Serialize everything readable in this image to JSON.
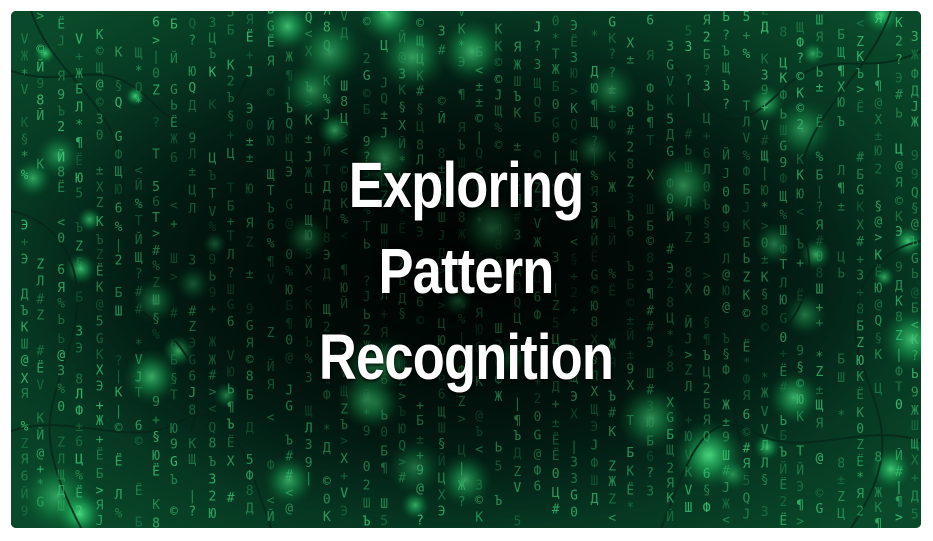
{
  "banner": {
    "title_lines": [
      "Exploring",
      "Pattern",
      "Recognition"
    ]
  },
  "colors": {
    "background": "#02140c",
    "glow": "#20e070",
    "glyph": "#3fd07a",
    "title": "#ffffff",
    "frame": "#ffffff"
  },
  "background_glyphs": [
    "Й",
    "К",
    "Ж",
    "Ш",
    "Ё",
    "Ъ",
    "Щ",
    "Ц",
    "Б",
    "Ф",
    "Я",
    "Ю",
    "Э",
    "Ь",
    "Д",
    "Л",
    "G",
    "V",
    "Q",
    "X",
    "Z",
    "T",
    "J",
    "K",
    "3",
    "6",
    "8",
    "9",
    "2",
    "5",
    "0",
    "¶",
    "§",
    "@",
    "#",
    "%",
    "±",
    "©",
    "?",
    "*",
    "+",
    "<",
    ">",
    "|"
  ]
}
